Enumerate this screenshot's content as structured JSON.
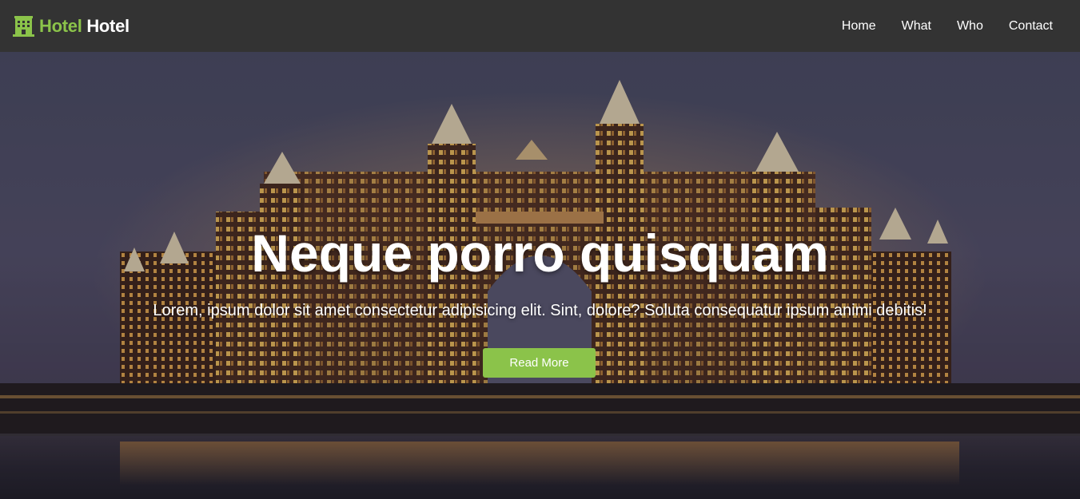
{
  "brand": {
    "accent_word": "Hotel",
    "main_word": "Hotel",
    "icon": "hotel-building-icon",
    "accent_color": "#8bc34a"
  },
  "nav": {
    "items": [
      {
        "label": "Home"
      },
      {
        "label": "What"
      },
      {
        "label": "Who"
      },
      {
        "label": "Contact"
      }
    ],
    "background_color": "#333333"
  },
  "hero": {
    "background": "night-resort-hotel-photo",
    "title": "Neque porro quisquam",
    "text": "Lorem, ipsum dolor sit amet consectetur adipisicing elit. Sint, dolore? Soluta consequatur ipsum animi debitis!",
    "button_label": "Read More",
    "button_color": "#8bc34a"
  }
}
